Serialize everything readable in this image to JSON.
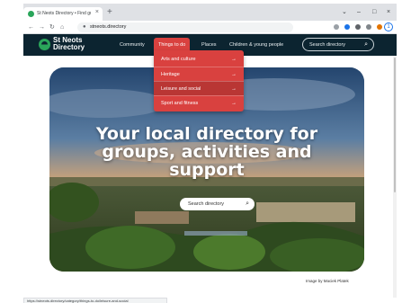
{
  "browser": {
    "tab_title": "St Neots Directory • Find group…",
    "tab_close": "×",
    "new_tab": "+",
    "url": "stneots.directory",
    "window_controls": {
      "minimize": "–",
      "maximize": "□",
      "close": "×",
      "expand": "⌄"
    },
    "nav": {
      "back": "←",
      "forward": "→",
      "reload": "↻",
      "home": "⌂"
    },
    "profile": "1",
    "status_url": "https://stneots.directory/category/things-to-do/leisure-and-social"
  },
  "site": {
    "logo": {
      "line1": "St Neots",
      "line2": "Directory"
    },
    "nav": [
      {
        "label": "Community"
      },
      {
        "label": "Things to do"
      },
      {
        "label": "Places"
      },
      {
        "label": "Children & young people"
      }
    ],
    "search_placeholder": "Search directory",
    "search_icon": "⚲"
  },
  "dropdown": {
    "items": [
      {
        "label": "Arts and culture",
        "arrow": "→"
      },
      {
        "label": "Heritage",
        "arrow": "→"
      },
      {
        "label": "Leisure and social",
        "arrow": "→"
      },
      {
        "label": "Sport and fitness",
        "arrow": "→"
      }
    ]
  },
  "hero": {
    "title_line1": "Your local directory for",
    "title_line2": "groups, activities and",
    "title_line3": "support",
    "search_placeholder": "Search directory",
    "image_credit": "Image by Maciek Platek"
  },
  "colors": {
    "header_bg": "#0c2430",
    "accent_red": "#d9413f",
    "brand_green": "#2aa55a"
  }
}
